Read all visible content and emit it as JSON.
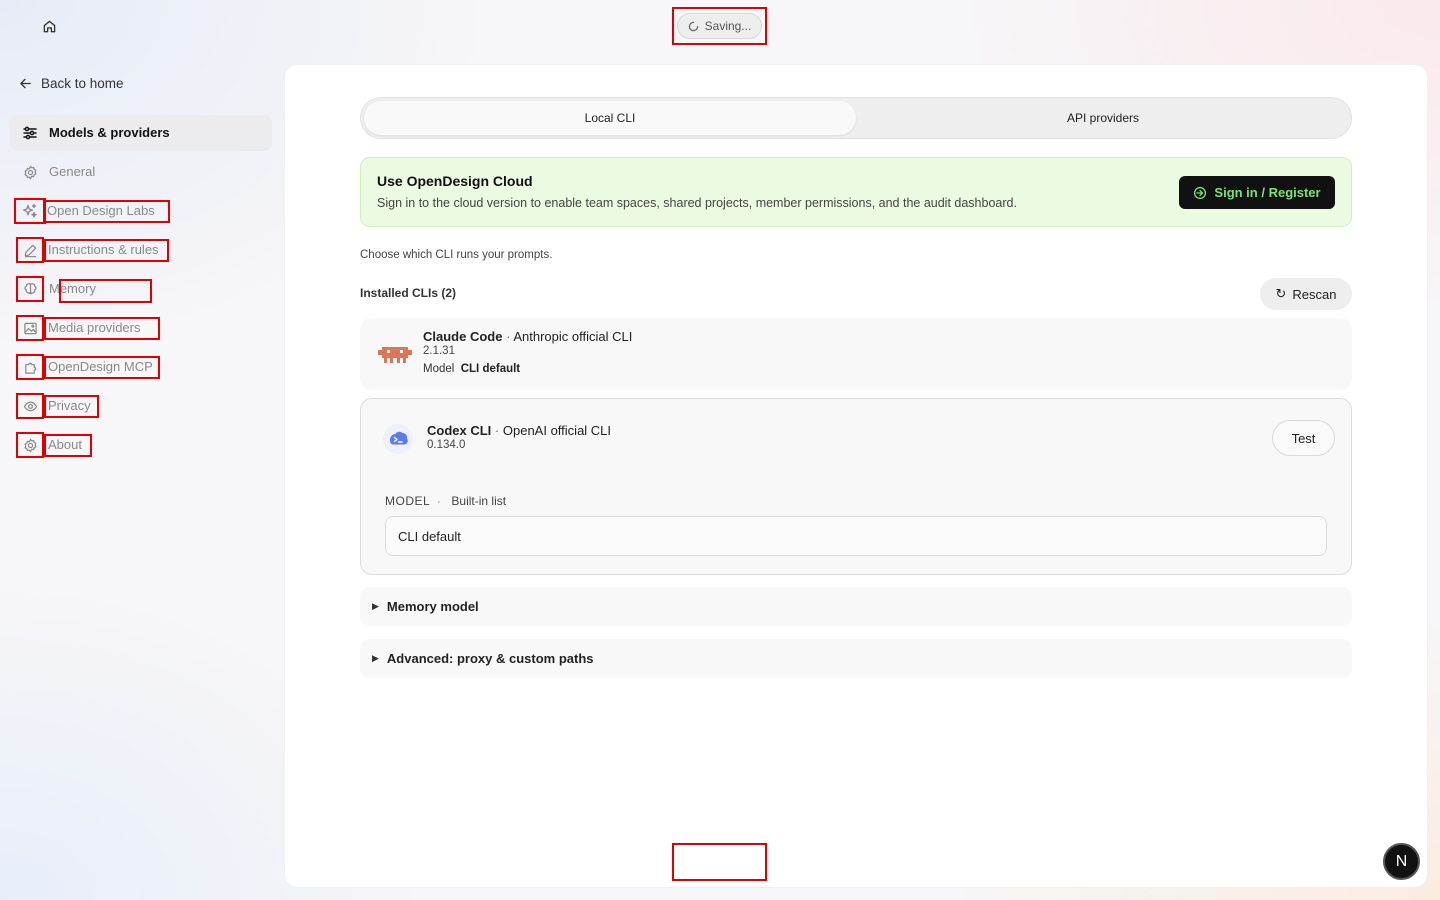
{
  "status": {
    "saving_label": "Saving..."
  },
  "sidebar": {
    "back_label": "Back to home",
    "items": [
      {
        "label": "Models & providers",
        "icon": "sliders-icon"
      },
      {
        "label": "General",
        "icon": "gear-icon"
      },
      {
        "label": "Open Design Labs",
        "icon": "sparkles-icon"
      },
      {
        "label": "Instructions & rules",
        "icon": "pencil-icon"
      },
      {
        "label": "Memory",
        "icon": "brain-icon"
      },
      {
        "label": "Media providers",
        "icon": "image-icon"
      },
      {
        "label": "OpenDesign MCP",
        "icon": "puzzle-icon"
      },
      {
        "label": "Privacy",
        "icon": "eye-icon"
      },
      {
        "label": "About",
        "icon": "gear-icon"
      }
    ]
  },
  "tabs": {
    "local_cli": "Local CLI",
    "api_providers": "API providers"
  },
  "cloud_banner": {
    "title": "Use OpenDesign Cloud",
    "description": "Sign in to the cloud version to enable team spaces, shared projects, member permissions, and the audit dashboard.",
    "button_label": "Sign in / Register"
  },
  "cli_section": {
    "intro": "Choose which CLI runs your prompts.",
    "installed_label": "Installed CLIs (2)",
    "rescan_label": "Rescan",
    "clis": [
      {
        "name": "Claude Code",
        "description": "Anthropic official CLI",
        "version": "2.1.31",
        "model_key": "Model",
        "model_value": "CLI default"
      },
      {
        "name": "Codex CLI",
        "description": "OpenAI official CLI",
        "version": "0.134.0",
        "test_label": "Test",
        "model_heading": "MODEL",
        "model_source": "Built-in list",
        "model_value": "CLI default"
      }
    ]
  },
  "sections": {
    "memory_model": "Memory model",
    "advanced": "Advanced: proxy & custom paths"
  },
  "badge": {
    "letter": "N"
  },
  "colors": {
    "highlight": "#e00000",
    "banner_bg": "#ebfbe2",
    "signin_bg": "#111111",
    "signin_text": "#7ee07e",
    "claude_brand": "#d97757",
    "codex_brand": "#5b7cf0"
  }
}
